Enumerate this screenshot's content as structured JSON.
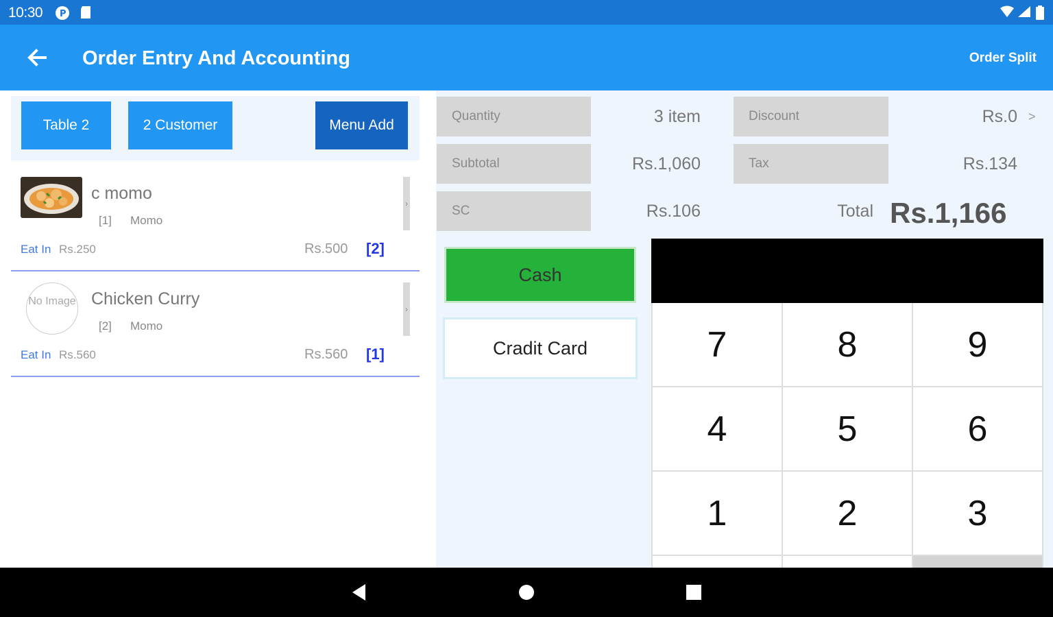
{
  "status": {
    "time": "10:30"
  },
  "appbar": {
    "title": "Order Entry And Accounting",
    "action": "Order Split"
  },
  "toolbar": {
    "table": "Table 2",
    "customer": "2 Customer",
    "menu_add": "Menu Add"
  },
  "items": [
    {
      "name": "c momo",
      "qty_tag": "[1]",
      "category": "Momo",
      "eat": "Eat In",
      "unit_price": "Rs.250",
      "amount": "Rs.500",
      "count": "[2]",
      "has_image": true
    },
    {
      "name": "Chicken Curry",
      "qty_tag": "[2]",
      "category": "Momo",
      "eat": "Eat In",
      "unit_price": "Rs.560",
      "amount": "Rs.560",
      "count": "[1]",
      "has_image": false,
      "no_image_text": "No Image"
    }
  ],
  "summary": {
    "quantity_label": "Quantity",
    "quantity_value": "3 item",
    "discount_label": "Discount",
    "discount_value": "Rs.0",
    "subtotal_label": "Subtotal",
    "subtotal_value": "Rs.1,060",
    "tax_label": "Tax",
    "tax_value": "Rs.134",
    "sc_label": "SC",
    "sc_value": "Rs.106",
    "total_label": "Total",
    "total_value": "Rs.1,166",
    "discount_chevron": ">"
  },
  "payment": {
    "cash": "Cash",
    "credit": "Cradit Card"
  },
  "keypad": {
    "keys": [
      "7",
      "8",
      "9",
      "4",
      "5",
      "6",
      "1",
      "2",
      "3"
    ]
  },
  "colors": {
    "primary": "#2196f3",
    "status": "#1976d2",
    "cash": "#25b23a",
    "accent_blue": "#2437e6"
  }
}
